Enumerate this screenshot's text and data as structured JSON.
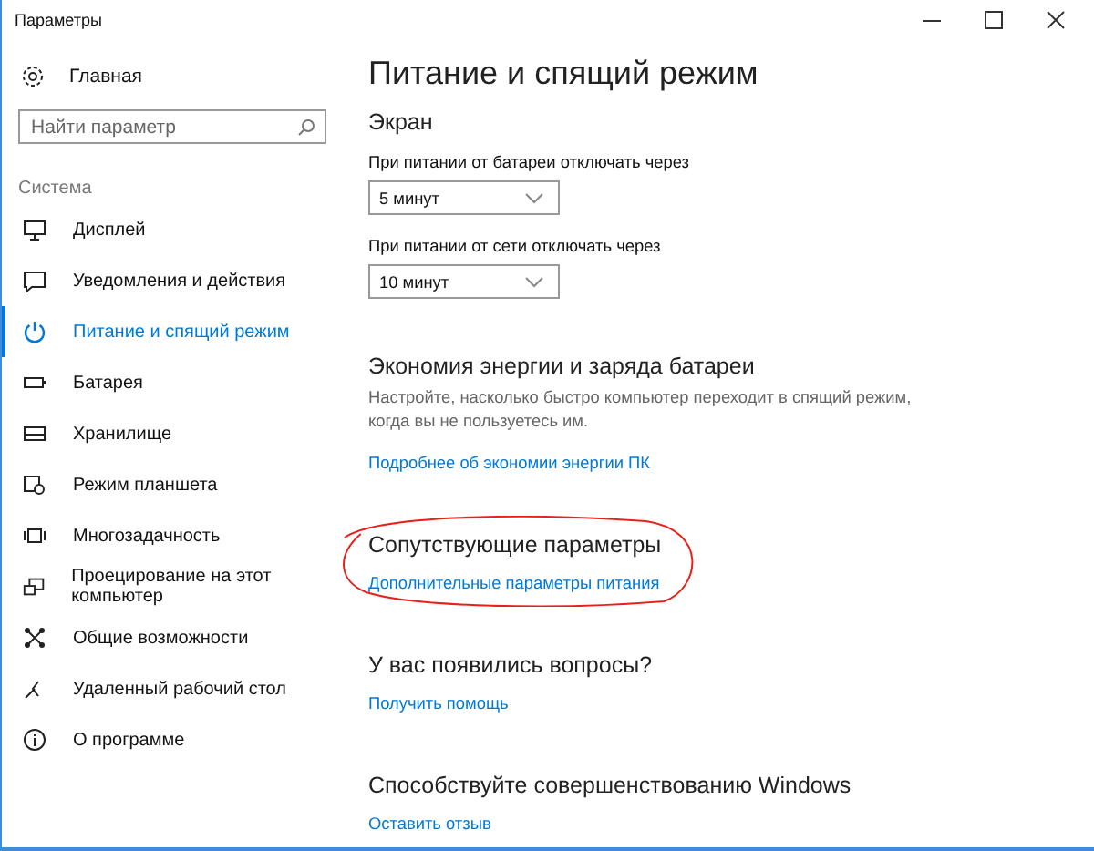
{
  "window": {
    "title": "Параметры"
  },
  "sidebar": {
    "home": "Главная",
    "search": {
      "placeholder": "Найти параметр"
    },
    "section": "Система",
    "items": [
      {
        "label": "Дисплей",
        "selected": false
      },
      {
        "label": "Уведомления и действия",
        "selected": false
      },
      {
        "label": "Питание и спящий режим",
        "selected": true
      },
      {
        "label": "Батарея",
        "selected": false
      },
      {
        "label": "Хранилище",
        "selected": false
      },
      {
        "label": "Режим планшета",
        "selected": false
      },
      {
        "label": "Многозадачность",
        "selected": false
      },
      {
        "label": "Проецирование на этот компьютер",
        "selected": false
      },
      {
        "label": "Общие возможности",
        "selected": false
      },
      {
        "label": "Удаленный рабочий стол",
        "selected": false
      },
      {
        "label": "О программе",
        "selected": false
      }
    ]
  },
  "main": {
    "title": "Питание и спящий режим",
    "screen": {
      "heading": "Экран",
      "settings": [
        {
          "label": "При питании от батареи отключать через",
          "value": "5 минут"
        },
        {
          "label": "При питании от сети отключать через",
          "value": "10 минут"
        }
      ]
    },
    "sections": [
      {
        "heading": "Экономия энергии и заряда батареи",
        "description": "Настройте, насколько быстро компьютер переходит в спящий режим, когда вы не пользуетесь им.",
        "link": "Подробнее об экономии энергии ПК",
        "circled": false
      },
      {
        "heading": "Сопутствующие параметры",
        "link": "Дополнительные параметры питания",
        "circled": true
      },
      {
        "heading": "У вас появились вопросы?",
        "link": "Получить помощь",
        "circled": false
      },
      {
        "heading": "Способствуйте совершенствованию Windows",
        "link": "Оставить отзыв",
        "circled": false
      }
    ]
  }
}
